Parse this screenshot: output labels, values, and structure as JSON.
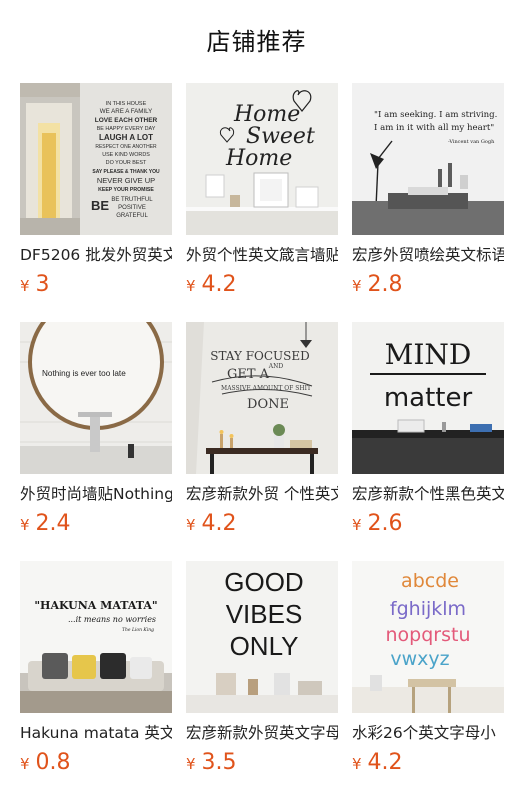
{
  "header": {
    "title": "店铺推荐"
  },
  "currency_symbol": "¥",
  "colors": {
    "price": "#e0531b"
  },
  "products": [
    {
      "name": "DF5206 批发外贸英文",
      "price": "3",
      "art_lines": [
        "IN THIS HOUSE",
        "WE ARE A FAMILY",
        "LOVE EACH OTHER",
        "BE HAPPY EVERY DAY",
        "LAUGH A LOT",
        "RESPECT ONE ANOTHER",
        "USE KIND WORDS",
        "DO YOUR BEST",
        "SAY PLEASE & THANK YOU",
        "NEVER GIVE UP",
        "KEEP YOUR PROMISE",
        "BE TRUTHFUL",
        "POSITIVE",
        "GRATEFUL"
      ]
    },
    {
      "name": "外贸个性英文箴言墙贴",
      "price": "4.2",
      "art_lines": [
        "Home",
        "Sweet",
        "Home"
      ]
    },
    {
      "name": "宏彦外贸喷绘英文标语",
      "price": "2.8",
      "art_lines": [
        "\"I am seeking. I am striving.",
        "I am in it with all my heart\"",
        "-Vincent van Gogh"
      ]
    },
    {
      "name": "外贸时尚墙贴Nothing",
      "price": "2.4",
      "art_lines": [
        "Nothing is ever too late"
      ]
    },
    {
      "name": "宏彦新款外贸 个性英文",
      "price": "4.2",
      "art_lines": [
        "STAY FOCUSED",
        "AND",
        "GET A",
        "MASSIVE AMOUNT OF SHIT",
        "DONE"
      ]
    },
    {
      "name": "宏彦新款个性黑色英文",
      "price": "2.6",
      "art_lines": [
        "MIND",
        "matter"
      ]
    },
    {
      "name": "Hakuna matata 英文",
      "price": "0.8",
      "art_lines": [
        "\"HAKUNA MATATA\"",
        "...it means no worries",
        "The Lion King"
      ]
    },
    {
      "name": "宏彦新款外贸英文字母",
      "price": "3.5",
      "art_lines": [
        "GOOD",
        "VIBES",
        "ONLY"
      ]
    },
    {
      "name": "水彩26个英文字母小",
      "price": "4.2",
      "art_lines": [
        "abcde",
        "fghijklm",
        "nopqrstu",
        "vwxyz"
      ]
    }
  ]
}
